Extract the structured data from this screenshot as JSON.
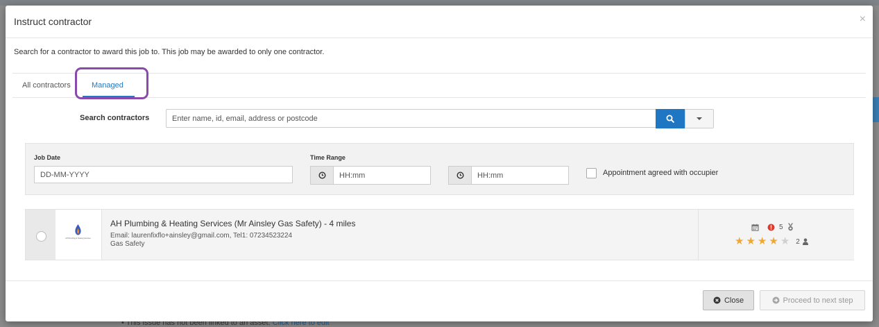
{
  "modal": {
    "title": "Instruct contractor",
    "close_glyph": "×",
    "intro": "Search for a contractor to award this job to. This job may be awarded to only one contractor."
  },
  "tabs": [
    {
      "label": "All contractors",
      "active": false
    },
    {
      "label": "Managed",
      "active": true
    }
  ],
  "search": {
    "label": "Search contractors",
    "placeholder": "Enter name, id, email, address or postcode",
    "value": "",
    "button_icon": "search-icon",
    "dropdown_icon": "caret-down-icon"
  },
  "filters": {
    "job_date_label": "Job Date",
    "job_date_placeholder": "DD-MM-YYYY",
    "time_range_label": "Time Range",
    "time_from_placeholder": "HH:mm",
    "time_to_placeholder": "HH:mm",
    "appointment_label": "Appointment agreed with occupier",
    "appointment_checked": false
  },
  "contractors": [
    {
      "name": "AH Plumbing & Heating Services (Mr Ainsley Gas Safety) - 4 miles",
      "contact": "Email: laurenfixflo+ainsley@gmail.com, Tel1: 07234523224",
      "trade": "Gas Safety",
      "logo_text": "AH Plumbing & Heating Services",
      "warnings": "5",
      "rating": 4,
      "rating_max": 5,
      "jobs": "2",
      "selected": false
    }
  ],
  "footer": {
    "close_label": "Close",
    "next_label": "Proceed to next step"
  },
  "background": {
    "text": "This issue has not been linked to an asset.",
    "link": "Click here to edit"
  },
  "colors": {
    "primary": "#1f76c2",
    "tab_active": "#2479c2",
    "highlight": "#8a4aac",
    "star_filled": "#f0a830",
    "star_empty": "#d0d0d0",
    "warning": "#e0392d"
  }
}
